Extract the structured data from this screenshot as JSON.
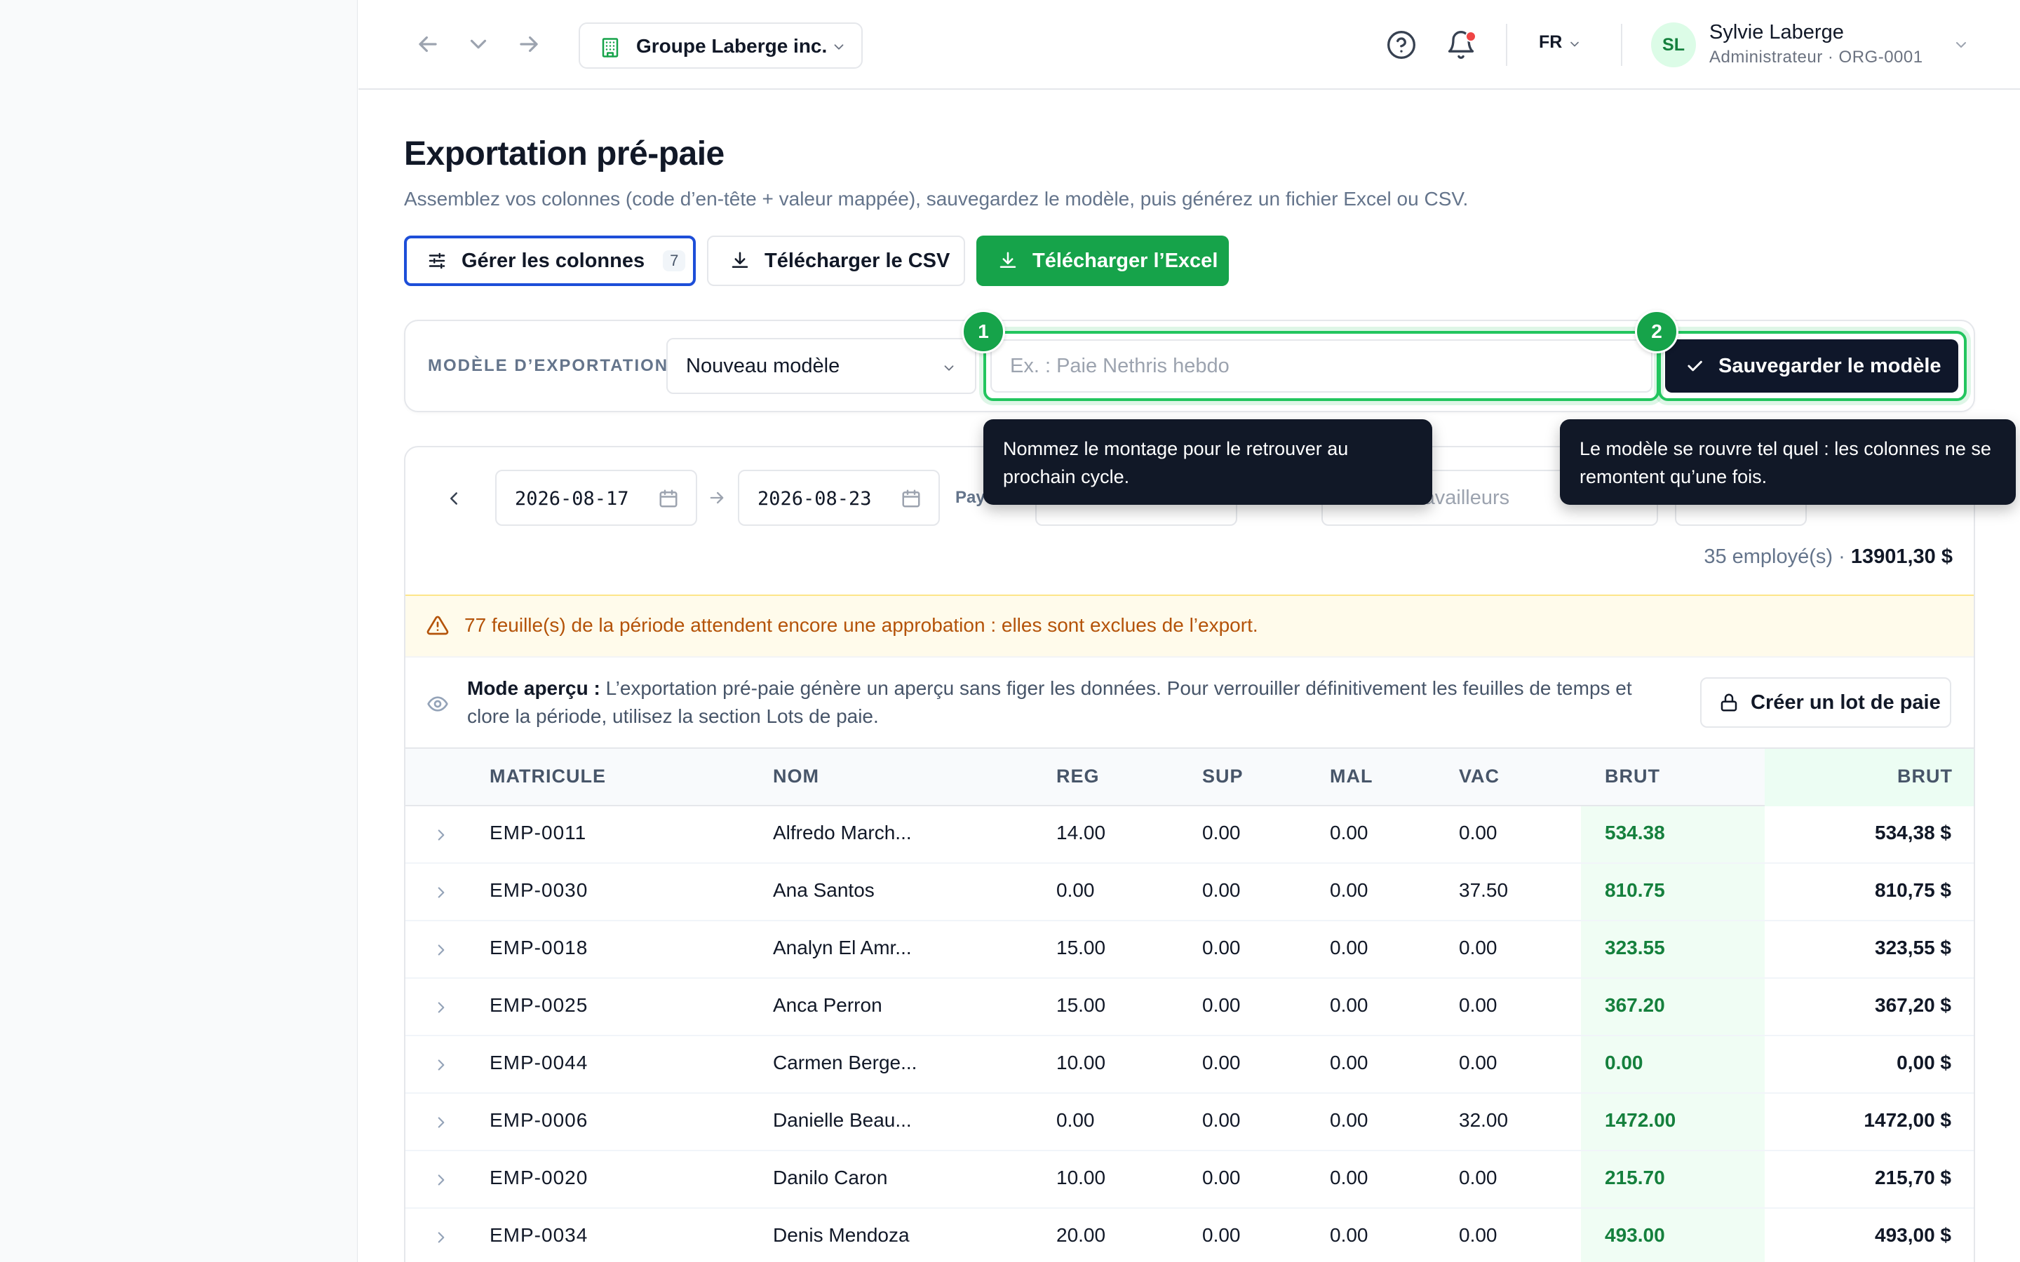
{
  "header": {
    "org_name": "Groupe Laberge inc.",
    "lang": "FR",
    "user": {
      "initials": "SL",
      "name": "Sylvie Laberge",
      "subtitle": "Administrateur · ORG-0001"
    }
  },
  "page": {
    "title": "Exportation pré-paie",
    "subtitle": "Assemblez vos colonnes (code d’en-tête + valeur mappée), sauvegardez le modèle, puis générez un fichier Excel ou CSV."
  },
  "actions": {
    "manage_columns": "Gérer les colonnes",
    "columns_count": "7",
    "download_csv": "Télécharger le CSV",
    "download_excel": "Télécharger l’Excel"
  },
  "template": {
    "label": "MODÈLE D’EXPORTATION",
    "selected": "Nouveau modèle",
    "name_value": "",
    "name_placeholder": "Ex. : Paie Nethris hebdo",
    "save_label": "Sauvegarder le modèle"
  },
  "tour": {
    "step1_num": "1",
    "step2_num": "2",
    "tip1": "Nommez le montage pour le retrouver au prochain cycle.",
    "tip2": "Le modèle se rouvre tel quel : les colonnes ne se remontent qu’une fois."
  },
  "filters": {
    "date_from": "2026-08-17",
    "date_to": "2026-08-23",
    "pay_label_partial": "Pay",
    "workers_placeholder_partial": "ravailleurs"
  },
  "summary": {
    "employees": "35 employé(s)",
    "separator": " · ",
    "total": "13901,30 $"
  },
  "warning": "77 feuille(s) de la période attendent encore une approbation : elles sont exclues de l’export.",
  "preview": {
    "label": "Mode aperçu :",
    "text": " L’exportation pré-paie génère un aperçu sans figer les données. Pour verrouiller définitivement les feuilles de temps et clore la période, utilisez la section Lots de paie.",
    "create_batch": "Créer un lot de paie"
  },
  "table": {
    "columns": [
      "MATRICULE",
      "NOM",
      "REG",
      "SUP",
      "MAL",
      "VAC",
      "BRUT",
      "BRUT"
    ],
    "rows": [
      [
        "EMP-0011",
        "Alfredo March...",
        "14.00",
        "0.00",
        "0.00",
        "0.00",
        "534.38",
        "534,38 $"
      ],
      [
        "EMP-0030",
        "Ana Santos",
        "0.00",
        "0.00",
        "0.00",
        "37.50",
        "810.75",
        "810,75 $"
      ],
      [
        "EMP-0018",
        "Analyn El Amr...",
        "15.00",
        "0.00",
        "0.00",
        "0.00",
        "323.55",
        "323,55 $"
      ],
      [
        "EMP-0025",
        "Anca Perron",
        "15.00",
        "0.00",
        "0.00",
        "0.00",
        "367.20",
        "367,20 $"
      ],
      [
        "EMP-0044",
        "Carmen Berge...",
        "10.00",
        "0.00",
        "0.00",
        "0.00",
        "0.00",
        "0,00 $"
      ],
      [
        "EMP-0006",
        "Danielle Beau...",
        "0.00",
        "0.00",
        "0.00",
        "32.00",
        "1472.00",
        "1472,00 $"
      ],
      [
        "EMP-0020",
        "Danilo Caron",
        "10.00",
        "0.00",
        "0.00",
        "0.00",
        "215.70",
        "215,70 $"
      ],
      [
        "EMP-0034",
        "Denis Mendoza",
        "20.00",
        "0.00",
        "0.00",
        "0.00",
        "493.00",
        "493,00 $"
      ]
    ]
  },
  "colors": {
    "accent_green": "#16a34a",
    "focus_blue": "#1d4ed8",
    "dark": "#0f172a",
    "warning": "#b45309"
  }
}
